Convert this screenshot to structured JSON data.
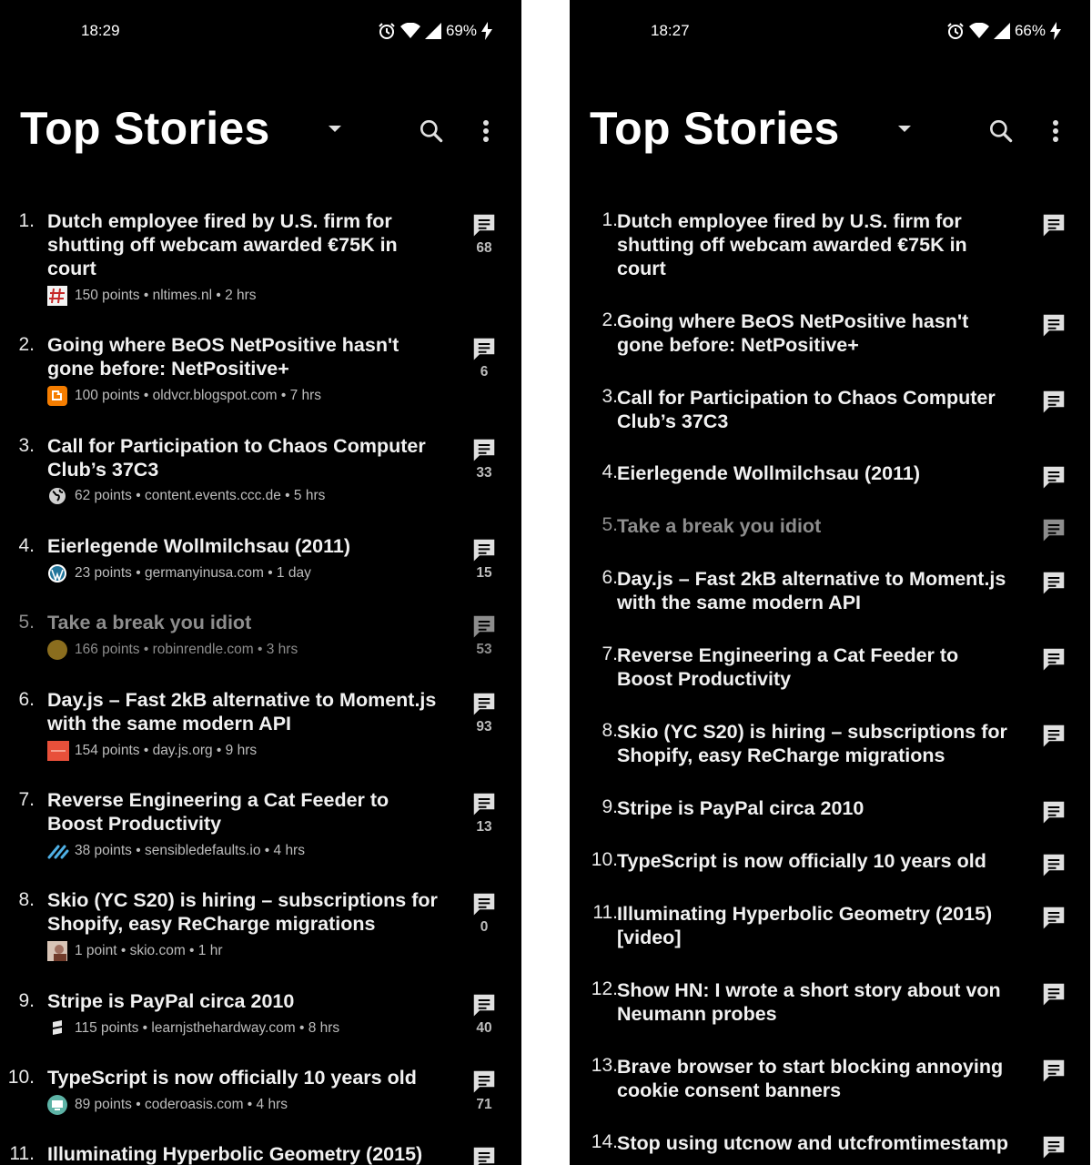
{
  "left": {
    "status": {
      "time": "18:29",
      "battery": "69%"
    },
    "title": "Top Stories",
    "stories": [
      {
        "n": "1.",
        "title": "Dutch employee fired by U.S. firm for shutting off webcam awarded €75K in court",
        "meta": "150 points • nltimes.nl • 2 hrs",
        "comments": "68"
      },
      {
        "n": "2.",
        "title": "Going where BeOS NetPositive hasn't gone before: NetPositive+",
        "meta": "100 points • oldvcr.blogspot.com • 7 hrs",
        "comments": "6"
      },
      {
        "n": "3.",
        "title": "Call for Participation to Chaos Computer Club’s 37C3",
        "meta": "62 points • content.events.ccc.de • 5 hrs",
        "comments": "33"
      },
      {
        "n": "4.",
        "title": "Eierlegende Wollmilchsau (2011)",
        "meta": "23 points • germanyinusa.com • 1 day",
        "comments": "15"
      },
      {
        "n": "5.",
        "title": "Take a break you idiot",
        "meta": "166 points • robinrendle.com • 3 hrs",
        "comments": "53"
      },
      {
        "n": "6.",
        "title": "Day.js – Fast 2kB alternative to Moment.js with the same modern API",
        "meta": "154 points • day.js.org • 9 hrs",
        "comments": "93"
      },
      {
        "n": "7.",
        "title": "Reverse Engineering a Cat Feeder to Boost Productivity",
        "meta": "38 points • sensibledefaults.io • 4 hrs",
        "comments": "13"
      },
      {
        "n": "8.",
        "title": "Skio (YC S20) is hiring – subscriptions for Shopify, easy ReCharge migrations",
        "meta": "1 point • skio.com • 1 hr",
        "comments": "0"
      },
      {
        "n": "9.",
        "title": "Stripe is PayPal circa 2010",
        "meta": "115 points • learnjsthehardway.com • 8 hrs",
        "comments": "40"
      },
      {
        "n": "10.",
        "title": "TypeScript is now officially 10 years old",
        "meta": "89 points • coderoasis.com • 4 hrs",
        "comments": "71"
      },
      {
        "n": "11.",
        "title": "Illuminating Hyperbolic Geometry (2015)",
        "meta": "",
        "comments": ""
      }
    ]
  },
  "right": {
    "status": {
      "time": "18:27",
      "battery": "66%"
    },
    "title": "Top Stories",
    "stories": [
      {
        "n": "1.",
        "title": "Dutch employee fired by U.S. firm for shutting off webcam awarded €75K in court"
      },
      {
        "n": "2.",
        "title": "Going where BeOS NetPositive hasn't gone before: NetPositive+"
      },
      {
        "n": "3.",
        "title": "Call for Participation to Chaos Computer Club’s 37C3"
      },
      {
        "n": "4.",
        "title": "Eierlegende Wollmilchsau (2011)"
      },
      {
        "n": "5.",
        "title": "Take a break you idiot"
      },
      {
        "n": "6.",
        "title": "Day.js – Fast 2kB alternative to Moment.js with the same modern API"
      },
      {
        "n": "7.",
        "title": "Reverse Engineering a Cat Feeder to Boost Productivity"
      },
      {
        "n": "8.",
        "title": "Skio (YC S20) is hiring – subscriptions for Shopify, easy ReCharge migrations"
      },
      {
        "n": "9.",
        "title": "Stripe is PayPal circa 2010"
      },
      {
        "n": "10.",
        "title": "TypeScript is now officially 10 years old"
      },
      {
        "n": "11.",
        "title": "Illuminating Hyperbolic Geometry (2015) [video]"
      },
      {
        "n": "12.",
        "title": "Show HN: I wrote a short story about von Neumann probes"
      },
      {
        "n": "13.",
        "title": "Brave browser to start blocking annoying cookie consent banners"
      },
      {
        "n": "14.",
        "title": "Stop using utcnow and utcfromtimestamp"
      }
    ]
  },
  "icons": {
    "status": [
      "alarm-icon",
      "wifi-icon",
      "signal-icon",
      "charging-icon"
    ],
    "appbar": [
      "dropdown-arrow-icon",
      "search-icon",
      "more-vert-icon"
    ],
    "comment": "comment-icon"
  },
  "colors": {
    "background": "#000000",
    "text": "#f1f1f1",
    "meta": "#bdbdbd",
    "read": "#8d8d8d"
  }
}
